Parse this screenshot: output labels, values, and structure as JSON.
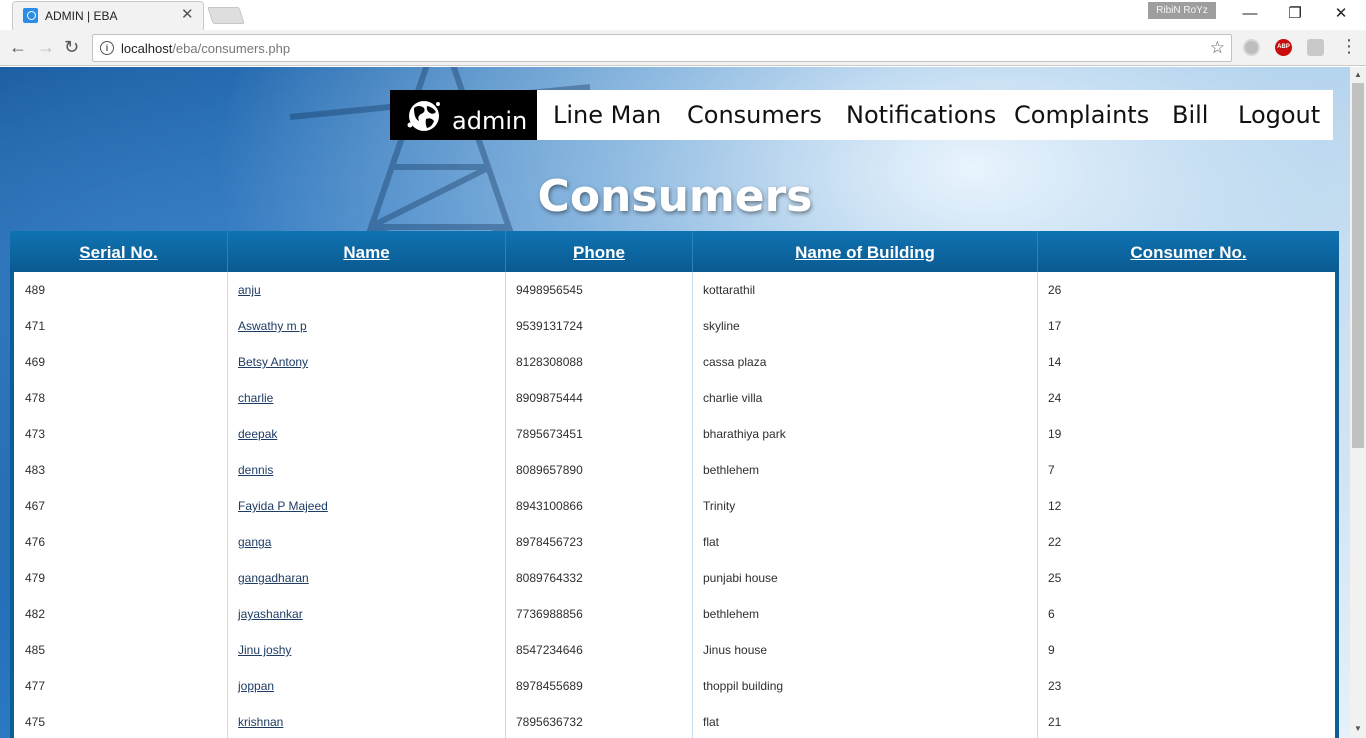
{
  "browser": {
    "tab_title": "ADMIN | EBA",
    "tab_close": "✕",
    "profile_name": "RibiN RoYz",
    "url_host": "localhost",
    "url_path": "/eba/consumers.php",
    "abp_label": "ABP",
    "window_controls": {
      "minimize": "—",
      "maximize": "❐",
      "close": "✕"
    },
    "nav_icons": {
      "back": "←",
      "forward": "→",
      "reload": "↻"
    }
  },
  "navbar": {
    "brand": "admin",
    "links": [
      "Line Man",
      "Consumers",
      "Notifications",
      "Complaints",
      "Bill",
      "Logout"
    ]
  },
  "page_title": "Consumers",
  "table": {
    "headers": [
      "Serial No.",
      "Name",
      "Phone",
      "Name of Building",
      "Consumer No."
    ],
    "rows": [
      {
        "serial": "489",
        "name": "anju",
        "phone": "9498956545",
        "building": "kottarathil",
        "consumer_no": "26"
      },
      {
        "serial": "471",
        "name": "Aswathy m p",
        "phone": "9539131724",
        "building": "skyline",
        "consumer_no": "17"
      },
      {
        "serial": "469",
        "name": "Betsy Antony",
        "phone": "8128308088",
        "building": "cassa plaza",
        "consumer_no": "14"
      },
      {
        "serial": "478",
        "name": "charlie",
        "phone": "8909875444",
        "building": "charlie villa",
        "consumer_no": "24"
      },
      {
        "serial": "473",
        "name": "deepak",
        "phone": "7895673451",
        "building": "bharathiya park",
        "consumer_no": "19"
      },
      {
        "serial": "483",
        "name": "dennis",
        "phone": "8089657890",
        "building": "bethlehem",
        "consumer_no": "7"
      },
      {
        "serial": "467",
        "name": "Fayida P Majeed",
        "phone": "8943100866",
        "building": "Trinity",
        "consumer_no": "12"
      },
      {
        "serial": "476",
        "name": "ganga",
        "phone": "8978456723",
        "building": "flat",
        "consumer_no": "22"
      },
      {
        "serial": "479",
        "name": "gangadharan",
        "phone": "8089764332",
        "building": "punjabi house",
        "consumer_no": "25"
      },
      {
        "serial": "482",
        "name": "jayashankar",
        "phone": "7736988856",
        "building": "bethlehem",
        "consumer_no": "6"
      },
      {
        "serial": "485",
        "name": "Jinu joshy",
        "phone": "8547234646",
        "building": "Jinus house",
        "consumer_no": "9"
      },
      {
        "serial": "477",
        "name": "joppan",
        "phone": "8978455689",
        "building": "thoppil building",
        "consumer_no": "23"
      },
      {
        "serial": "475",
        "name": "krishnan",
        "phone": "7895636732",
        "building": "flat",
        "consumer_no": "21"
      }
    ]
  }
}
